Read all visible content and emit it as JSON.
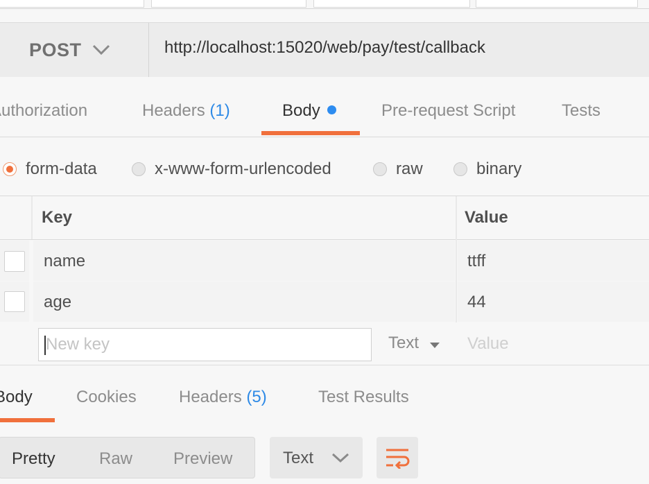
{
  "request": {
    "method": "POST",
    "url": "http://localhost:15020/web/pay/test/callback"
  },
  "request_tabs": [
    {
      "label": "Authorization",
      "count": ""
    },
    {
      "label": "Headers",
      "count": "(1)"
    },
    {
      "label": "Body",
      "count": ""
    },
    {
      "label": "Pre-request Script",
      "count": ""
    },
    {
      "label": "Tests",
      "count": ""
    }
  ],
  "body_types": [
    {
      "label": "form-data",
      "selected": true
    },
    {
      "label": "x-www-form-urlencoded",
      "selected": false
    },
    {
      "label": "raw",
      "selected": false
    },
    {
      "label": "binary",
      "selected": false
    }
  ],
  "table": {
    "key_header": "Key",
    "value_header": "Value",
    "rows": [
      {
        "key": "name",
        "value": "ttff"
      },
      {
        "key": "age",
        "value": "44"
      }
    ],
    "new_key_placeholder": "New key",
    "new_type": "Text",
    "new_value_placeholder": "Value"
  },
  "response_tabs": [
    {
      "label": "Body",
      "count": ""
    },
    {
      "label": "Cookies",
      "count": ""
    },
    {
      "label": "Headers",
      "count": "(5)"
    },
    {
      "label": "Test Results",
      "count": ""
    }
  ],
  "view_modes": [
    "Pretty",
    "Raw",
    "Preview"
  ],
  "format": "Text",
  "colors": {
    "accent": "#f0703c",
    "count_blue": "#2e8ae6",
    "body_dot": "#2d8cf0"
  }
}
